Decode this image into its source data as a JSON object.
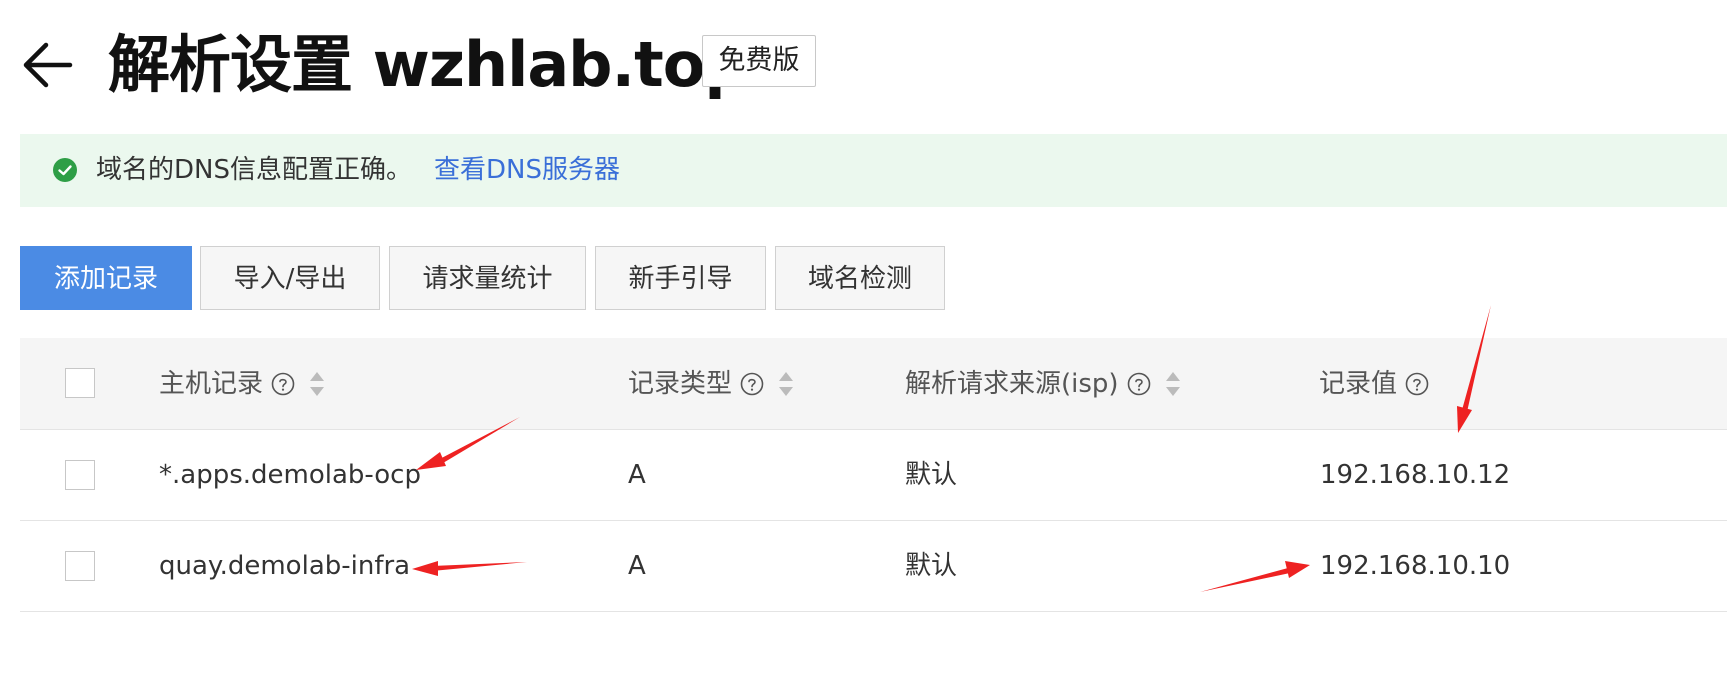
{
  "header": {
    "back_icon": "arrow-left-icon",
    "title": "解析设置 wzhlab.top",
    "plan_badge": "免费版"
  },
  "alert": {
    "icon": "check-circle-icon",
    "message": "域名的DNS信息配置正确。",
    "link": "查看DNS服务器",
    "colors": {
      "background": "#ebf8ee",
      "icon": "#2e9e46",
      "link": "#3a6fd8"
    }
  },
  "toolbar": {
    "buttons": [
      "添加记录",
      "导入/导出",
      "请求量统计",
      "新手引导",
      "域名检测"
    ],
    "primary_color": "#4b8be4"
  },
  "table": {
    "columns": [
      {
        "label": "主机记录",
        "help": true,
        "sortable": true
      },
      {
        "label": "记录类型",
        "help": true,
        "sortable": true
      },
      {
        "label": "解析请求来源(isp)",
        "help": true,
        "sortable": true
      },
      {
        "label": "记录值",
        "help": true,
        "sortable": false
      }
    ],
    "rows": [
      {
        "host": "*.apps.demolab-ocp",
        "type": "A",
        "isp": "默认",
        "value": "192.168.10.12"
      },
      {
        "host": "quay.demolab-infra",
        "type": "A",
        "isp": "默认",
        "value": "192.168.10.10"
      }
    ]
  },
  "annotations": {
    "arrow_color": "#ee2222",
    "count": 4
  }
}
